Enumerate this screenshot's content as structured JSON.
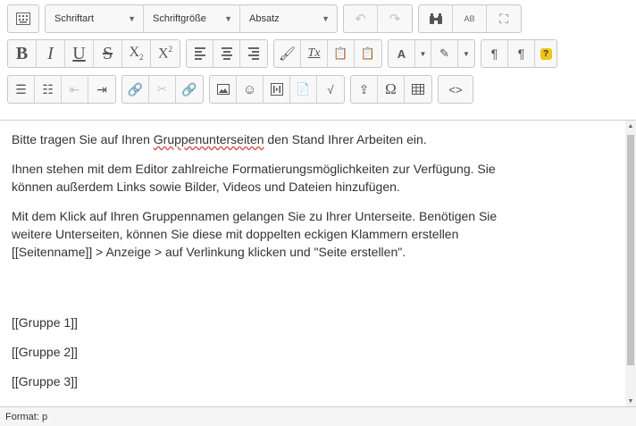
{
  "toolbar": {
    "font_family": "Schriftart",
    "font_size": "Schriftgröße",
    "paragraph_format": "Absatz",
    "subscript_letter": "X",
    "subscript_digit": "2",
    "superscript_letter": "X",
    "superscript_digit": "2",
    "clear_format_letter": "Tx",
    "case_letters": "AB",
    "help_glyph": "?"
  },
  "content": {
    "line1_prefix": "Bitte tragen Sie auf Ihren ",
    "line1_link": "Gruppenunterseiten",
    "line1_suffix": " den Stand Ihrer Arbeiten ein.",
    "para2_line1": "Ihnen stehen mit dem Editor zahlreiche Formatierungsmöglichkeiten zur Verfügung. Sie",
    "para2_line2": "können außerdem Links sowie Bilder, Videos und Dateien hinzufügen.",
    "para3_line1": "Mit dem Klick auf Ihren Gruppennamen gelangen Sie zu Ihrer Unterseite. Benötigen Sie",
    "para3_line2": "weitere Unterseiten, können Sie diese mit doppelten eckigen Klammern erstellen",
    "para3_line3": "[[Seitenname]] > Anzeige > auf Verlinkung klicken und \"Seite erstellen\".",
    "group1": "[[Gruppe 1]]",
    "group2": "[[Gruppe 2]]",
    "group3": "[[Gruppe 3]]"
  },
  "statusbar": {
    "format": "Format: p"
  },
  "colors": {
    "help_badge": "#f0c419",
    "spellcheck": "#d9534f"
  }
}
